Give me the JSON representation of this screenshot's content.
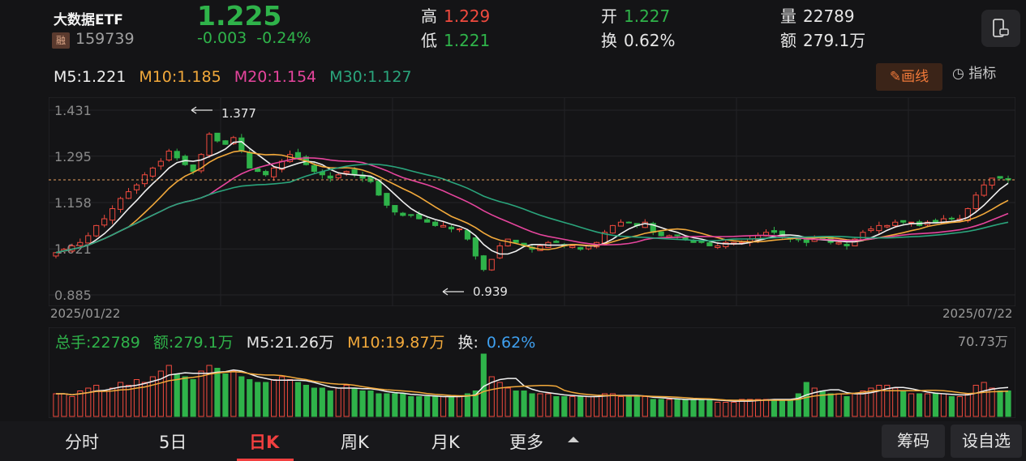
{
  "header": {
    "name": "大数据ETF",
    "badge": "融",
    "code": "159739",
    "price": "1.225",
    "change": "-0.003",
    "change_pct": "-0.24%",
    "high_label": "高",
    "high": "1.229",
    "low_label": "低",
    "low": "1.221",
    "open_label": "开",
    "open": "1.227",
    "turnover_label": "换",
    "turnover": "0.62%",
    "volume_label": "量",
    "volume": "22789",
    "amount_label": "额",
    "amount": "279.1万"
  },
  "ma": {
    "ma5": "M5:1.221",
    "ma10": "M10:1.185",
    "ma20": "M20:1.154",
    "ma30": "M30:1.127"
  },
  "toolbar": {
    "draw_label": "画线",
    "index_label": "指标"
  },
  "chart_data": {
    "type": "candlestick",
    "y_ticks": [
      "1.431",
      "1.295",
      "1.158",
      "1.021",
      "0.885"
    ],
    "ylim": [
      0.885,
      1.431
    ],
    "start_date": "2025/01/22",
    "end_date": "2025/07/22",
    "max_annotation": "1.377",
    "min_annotation": "0.939",
    "current_price": 1.225,
    "closes": [
      1.01,
      1.02,
      1.03,
      1.04,
      1.06,
      1.09,
      1.11,
      1.14,
      1.17,
      1.19,
      1.21,
      1.24,
      1.26,
      1.28,
      1.31,
      1.29,
      1.27,
      1.25,
      1.3,
      1.36,
      1.34,
      1.33,
      1.35,
      1.31,
      1.26,
      1.25,
      1.24,
      1.26,
      1.28,
      1.3,
      1.29,
      1.27,
      1.25,
      1.24,
      1.23,
      1.24,
      1.25,
      1.24,
      1.23,
      1.22,
      1.18,
      1.15,
      1.13,
      1.12,
      1.12,
      1.11,
      1.1,
      1.09,
      1.09,
      1.08,
      1.08,
      1.05,
      1.0,
      0.96,
      0.99,
      1.03,
      1.05,
      1.04,
      1.03,
      1.02,
      1.03,
      1.04,
      1.04,
      1.03,
      1.03,
      1.02,
      1.03,
      1.04,
      1.07,
      1.09,
      1.1,
      1.1,
      1.09,
      1.1,
      1.07,
      1.06,
      1.06,
      1.06,
      1.05,
      1.04,
      1.04,
      1.03,
      1.03,
      1.04,
      1.04,
      1.04,
      1.05,
      1.06,
      1.07,
      1.07,
      1.06,
      1.05,
      1.05,
      1.04,
      1.05,
      1.05,
      1.04,
      1.04,
      1.03,
      1.05,
      1.07,
      1.08,
      1.09,
      1.09,
      1.1,
      1.1,
      1.1,
      1.09,
      1.1,
      1.1,
      1.11,
      1.11,
      1.11,
      1.14,
      1.18,
      1.21,
      1.23,
      1.23,
      1.225
    ],
    "volumes": [
      8,
      8,
      7,
      9,
      10,
      11,
      9,
      10,
      12,
      11,
      13,
      12,
      14,
      16,
      18,
      15,
      14,
      13,
      16,
      18,
      17,
      15,
      16,
      14,
      13,
      12,
      12,
      13,
      14,
      13,
      12,
      11,
      10,
      10,
      9,
      10,
      11,
      10,
      9,
      9,
      8,
      8,
      8,
      8,
      7,
      7,
      7,
      7,
      7,
      7,
      7,
      8,
      9,
      22,
      14,
      12,
      10,
      9,
      9,
      8,
      8,
      8,
      7,
      7,
      7,
      7,
      7,
      7,
      8,
      8,
      7,
      7,
      7,
      7,
      6,
      6,
      6,
      6,
      6,
      6,
      6,
      6,
      5,
      5,
      5,
      6,
      6,
      6,
      6,
      6,
      6,
      6,
      8,
      12,
      10,
      9,
      8,
      8,
      7,
      8,
      9,
      10,
      11,
      11,
      10,
      9,
      8,
      8,
      8,
      8,
      8,
      7,
      7,
      8,
      11,
      12,
      10,
      9,
      9
    ],
    "vol_ymax": "70.73万"
  },
  "volume_info": {
    "total": "总手:22789",
    "amount": "额:279.1万",
    "m5": "M5:21.26万",
    "m10": "M10:19.87万",
    "turnover_label": "换:",
    "turnover": "0.62%"
  },
  "tabs": {
    "t1": "分时",
    "t2": "5日",
    "t3": "日K",
    "t4": "周K",
    "t5": "月K",
    "t6": "更多",
    "chips": "筹码",
    "add_watch": "设自选"
  }
}
